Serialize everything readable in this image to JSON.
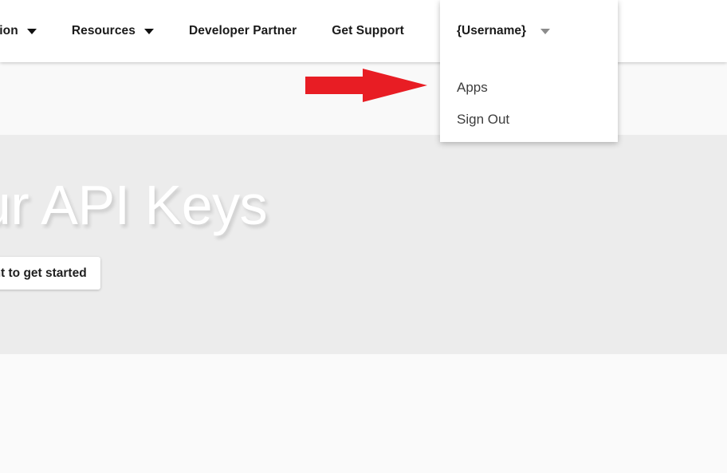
{
  "header": {
    "nav_items": [
      {
        "label": "tion",
        "has_caret": true,
        "caret_style": "dark",
        "truncated": true
      },
      {
        "label": "Resources",
        "has_caret": true,
        "caret_style": "dark",
        "truncated": false
      },
      {
        "label": "Developer Partner",
        "has_caret": false,
        "caret_style": "",
        "truncated": false
      },
      {
        "label": "Get Support",
        "has_caret": false,
        "caret_style": "",
        "truncated": false
      }
    ],
    "user_menu": {
      "label": "{Username}",
      "caret_icon": "chevron-down-icon",
      "expanded": true,
      "items": [
        {
          "label": "Apps"
        },
        {
          "label": "Sign Out"
        }
      ]
    }
  },
  "hero": {
    "title": "your API Keys",
    "cta_label": "n account to get started"
  },
  "annotation": {
    "arrow_icon": "right-arrow-icon",
    "color": "#e81d24",
    "points_to": "Apps"
  },
  "colors": {
    "header_bg": "#ffffff",
    "subband_bg": "#f9f9f9",
    "hero_bg": "#ececec",
    "lower_bg": "#fafafa",
    "nav_text": "#1a1a1a",
    "dropdown_text": "#3d3d3d",
    "hero_title": "#ffffff",
    "arrow_red": "#e81d24"
  }
}
